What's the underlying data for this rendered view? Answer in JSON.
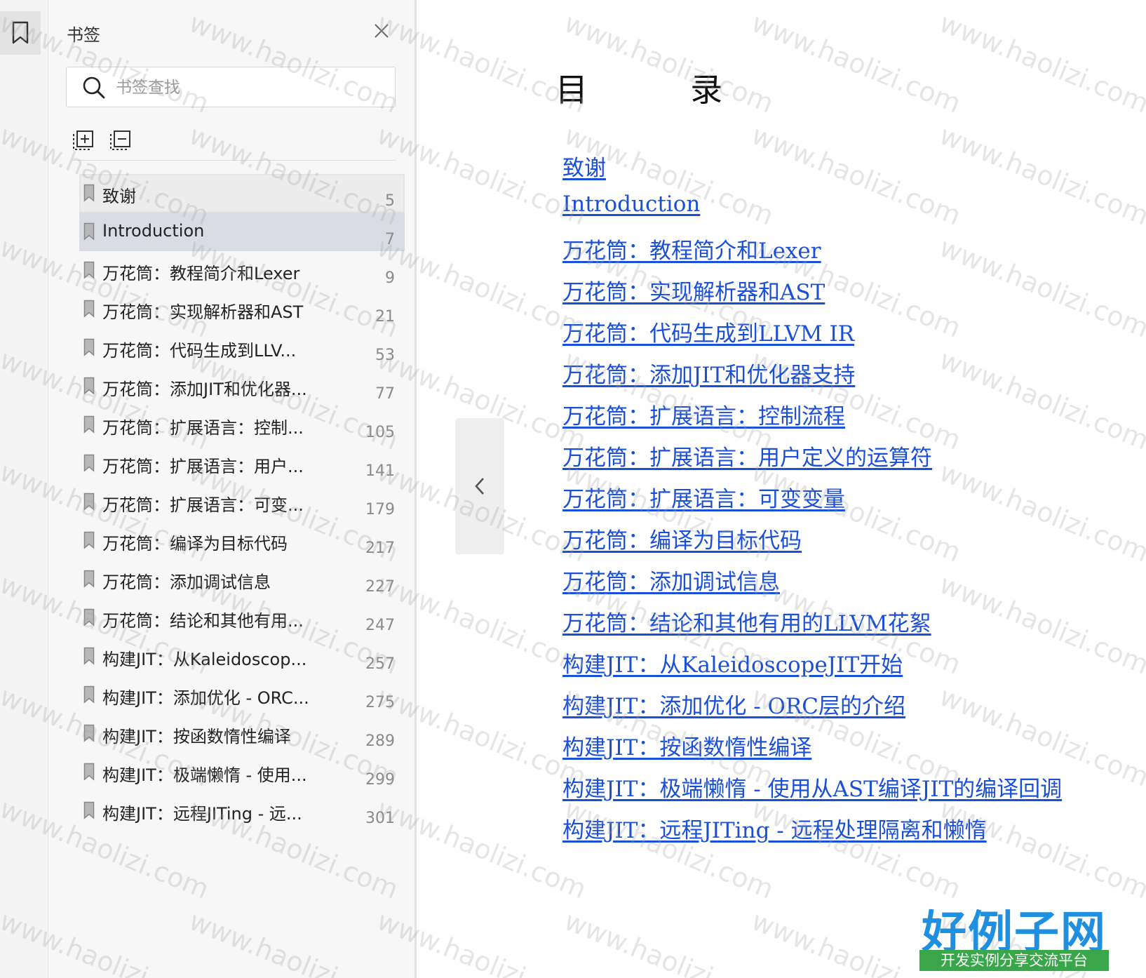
{
  "panel": {
    "title": "书签",
    "search": {
      "placeholder": "书签查找",
      "value": ""
    }
  },
  "icons": {
    "rail_bookmark": "bookmark-outline-icon",
    "close": "close-icon",
    "search": "search-icon",
    "expand_all": "expand-all-icon",
    "collapse_all": "collapse-all-icon",
    "collapse_panel": "chevron-left-icon"
  },
  "bookmarks": [
    {
      "label": "致谢",
      "page": "5"
    },
    {
      "label": "Introduction",
      "page": "7"
    },
    {
      "label": "万花筒：教程简介和Lexer",
      "page": "9"
    },
    {
      "label": "万花筒：实现解析器和AST",
      "page": "21"
    },
    {
      "label": "万花筒：代码生成到LLV...",
      "page": "53"
    },
    {
      "label": "万花筒：添加JIT和优化器...",
      "page": "77"
    },
    {
      "label": "万花筒：扩展语言：控制...",
      "page": "105"
    },
    {
      "label": "万花筒：扩展语言：用户...",
      "page": "141"
    },
    {
      "label": "万花筒：扩展语言：可变...",
      "page": "179"
    },
    {
      "label": "万花筒：编译为目标代码",
      "page": "217"
    },
    {
      "label": "万花筒：添加调试信息",
      "page": "227"
    },
    {
      "label": "万花筒：结论和其他有用...",
      "page": "247"
    },
    {
      "label": "构建JIT：从Kaleidoscop...",
      "page": "257"
    },
    {
      "label": "构建JIT：添加优化 - ORC...",
      "page": "275"
    },
    {
      "label": "构建JIT：按函数惰性编译",
      "page": "289"
    },
    {
      "label": "构建JIT：极端懒惰 - 使用...",
      "page": "299"
    },
    {
      "label": "构建JIT：远程JITing - 远...",
      "page": "301"
    }
  ],
  "document": {
    "title": "目          录",
    "toc": [
      "致谢",
      "Introduction",
      "万花筒：教程简介和Lexer",
      "万花筒：实现解析器和AST",
      "万花筒：代码生成到LLVM IR",
      "万花筒：添加JIT和优化器支持",
      "万花筒：扩展语言：控制流程",
      "万花筒：扩展语言：用户定义的运算符",
      "万花筒：扩展语言：可变变量",
      "万花筒：编译为目标代码",
      "万花筒：添加调试信息",
      "万花筒：结论和其他有用的LLVM花絮",
      "构建JIT：从KaleidoscopeJIT开始",
      "构建JIT：添加优化 - ORC层的介绍",
      "构建JIT：按函数惰性编译",
      "构建JIT：极端懒惰 - 使用从AST编译JIT的编译回调",
      "构建JIT：远程JITing - 远程处理隔离和懒惰"
    ]
  },
  "watermark": {
    "text": "www.haolizi.com"
  },
  "logo": {
    "main": "好例子网",
    "sub": "开发实例分享交流平台"
  },
  "colors": {
    "link": "#1a4fd8",
    "selected_row": "#d9dde3",
    "logo_blue": "#1f8fe0",
    "logo_green": "#3aa64a"
  }
}
